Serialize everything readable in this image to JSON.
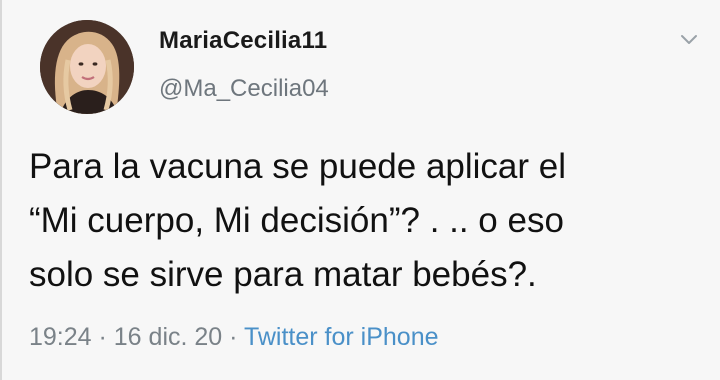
{
  "tweet": {
    "display_name": "MariaCecilia11",
    "handle": "@Ma_Cecilia04",
    "text_lines": [
      "Para la vacuna se puede aplicar el",
      "“Mi cuerpo, Mi decisión”? . .. o eso",
      "solo se sirve para matar bebés?."
    ],
    "time": "19:24",
    "separator": " · ",
    "date": "16 dic. 20",
    "source": "Twitter for iPhone"
  },
  "icons": {
    "menu": "chevron-down-icon",
    "avatar": "profile-photo"
  },
  "colors": {
    "name": "#1a1a1a",
    "handle": "#6e767d",
    "text": "#111111",
    "meta": "#7a8288",
    "link": "#4a90c8"
  }
}
